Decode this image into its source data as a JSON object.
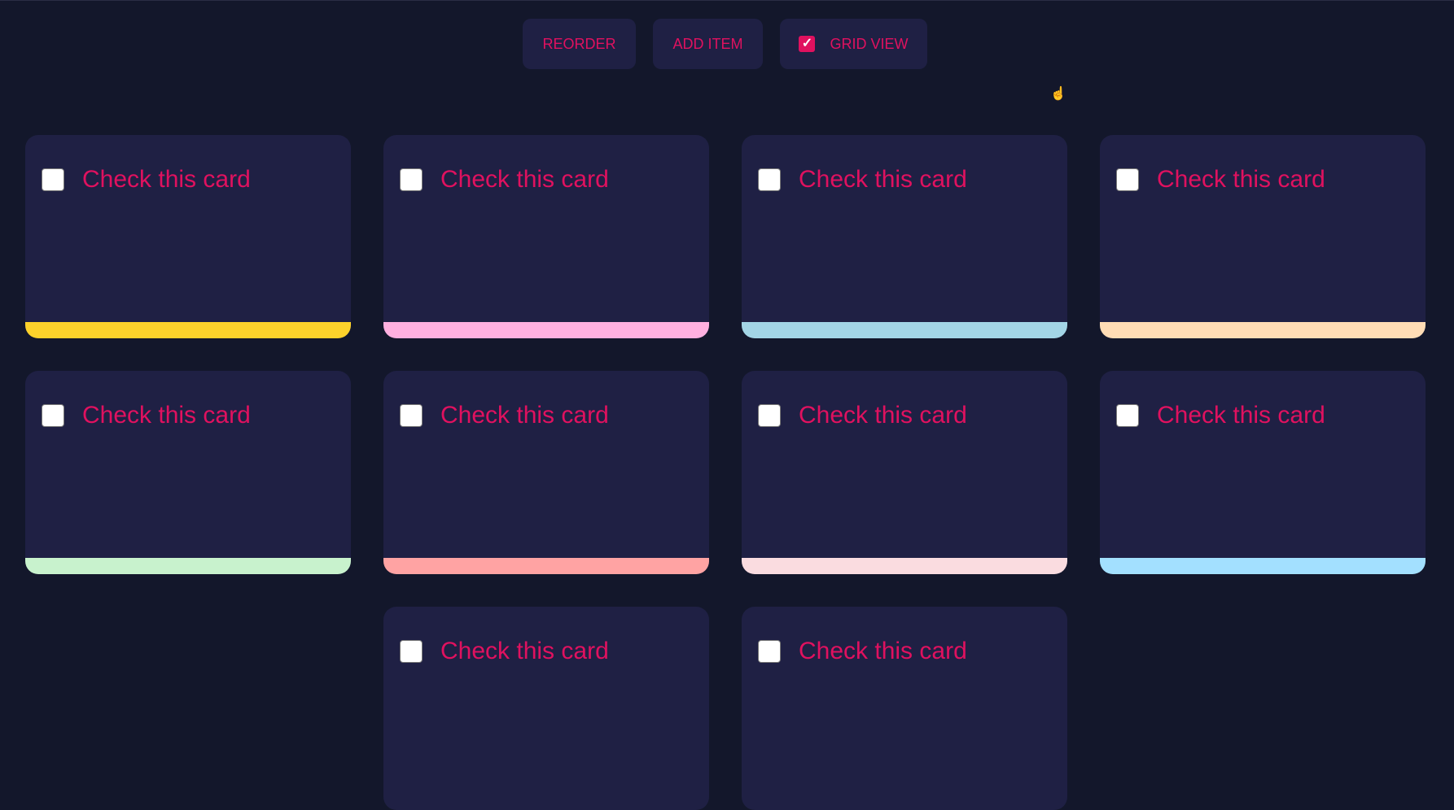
{
  "toolbar": {
    "reorder_label": "REORDER",
    "add_item_label": "ADD ITEM",
    "grid_view_label": "GRID VIEW",
    "grid_view_checked": true
  },
  "accent_color": "#e0115f",
  "cards": [
    {
      "label": "Check this card",
      "checked": false,
      "color": "#fdd22b"
    },
    {
      "label": "Check this card",
      "checked": false,
      "color": "#ffb0e0"
    },
    {
      "label": "Check this card",
      "checked": false,
      "color": "#a3d5e6"
    },
    {
      "label": "Check this card",
      "checked": false,
      "color": "#ffdcb5"
    },
    {
      "label": "Check this card",
      "checked": false,
      "color": "#c8f2cd"
    },
    {
      "label": "Check this card",
      "checked": false,
      "color": "#ffa3a3"
    },
    {
      "label": "Check this card",
      "checked": false,
      "color": "#fadce0"
    },
    {
      "label": "Check this card",
      "checked": false,
      "color": "#a3e0ff"
    },
    {
      "label": "Check this card",
      "checked": false,
      "color": ""
    },
    {
      "label": "Check this card",
      "checked": false,
      "color": ""
    }
  ]
}
